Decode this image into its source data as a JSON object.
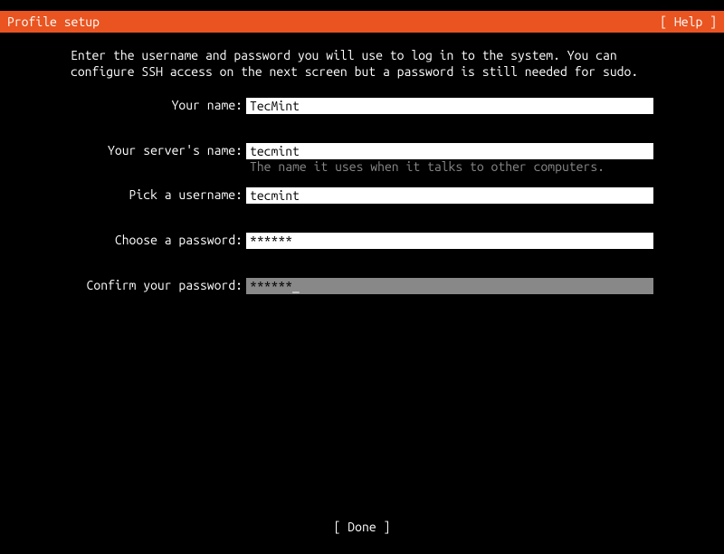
{
  "header": {
    "title": "Profile setup",
    "help": "[ Help ]"
  },
  "instructions": "Enter the username and password you will use to log in to the system. You can configure SSH access on the next screen but a password is still needed for sudo.",
  "fields": {
    "name": {
      "label": "Your name:",
      "value": "TecMint"
    },
    "server": {
      "label": "Your server's name:",
      "value": "tecmint",
      "hint": "The name it uses when it talks to other computers."
    },
    "username": {
      "label": "Pick a username:",
      "value": "tecmint"
    },
    "password": {
      "label": "Choose a password:",
      "value": "******"
    },
    "confirm": {
      "label": "Confirm your password:",
      "value": "******"
    }
  },
  "footer": {
    "done": "[ Done       ]"
  }
}
